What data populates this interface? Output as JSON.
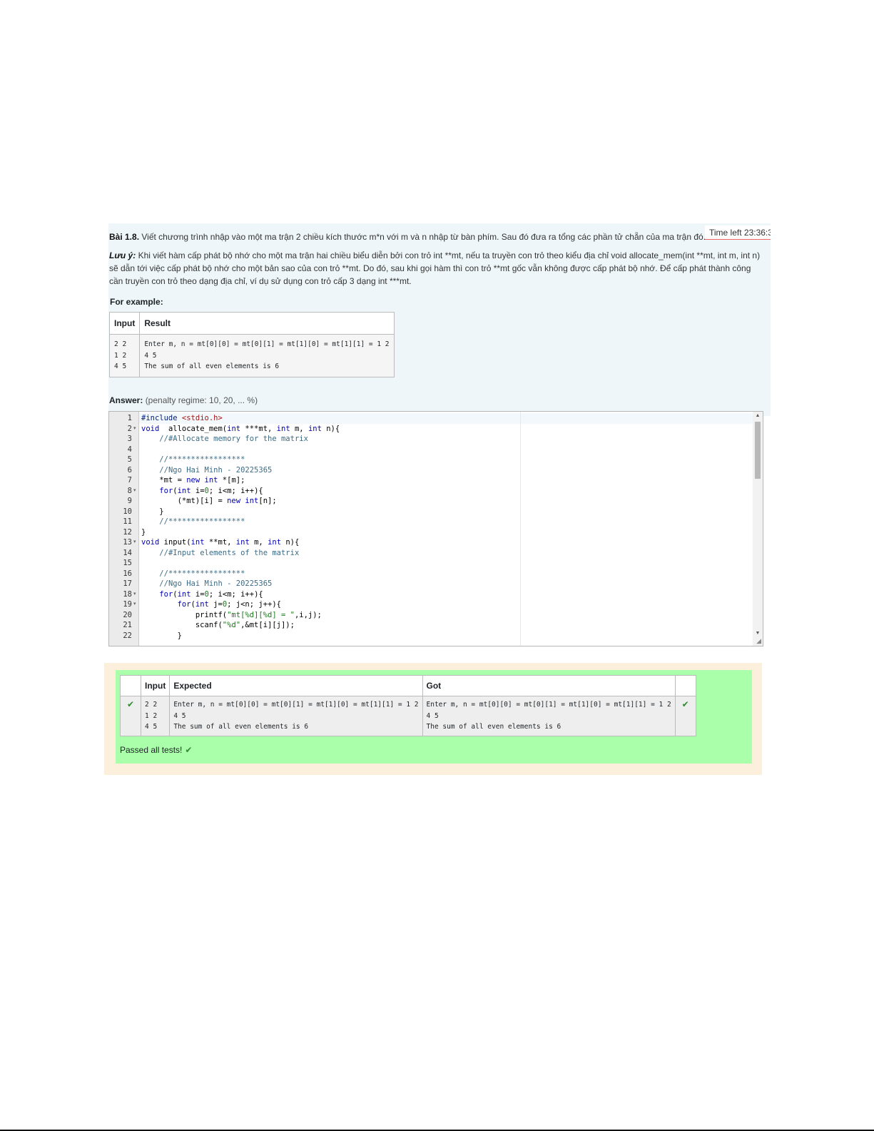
{
  "question": {
    "number_label": "Bài 1.8.",
    "text": "Viết chương trình nhập vào một ma trận 2 chiều kích thước m*n với m và n nhập từ bàn phím. Sau đó đưa ra tổng các phần tử chẵn của ma trận đó.",
    "note_label": "Lưu ý:",
    "note_text": "Khi viết hàm cấp phát bộ nhớ cho một ma trận hai chiều biểu diễn bởi con trỏ int **mt, nếu ta truyền con trỏ theo kiểu địa chỉ void allocate_mem(int **mt, int m, int n) sẽ dẫn tới việc cấp phát bộ nhớ cho một bản sao của con trỏ **mt. Do đó, sau khi gọi hàm thì con trỏ **mt gốc vẫn không được cấp phát bộ nhớ. Để cấp phát thành công cần truyền con trỏ theo dạng địa chỉ, ví dụ sử dụng con trỏ cấp 3 dạng int ***mt.",
    "example_label": "For example:"
  },
  "timer": {
    "label": "Time left 23:36:3"
  },
  "example_table": {
    "headers": [
      "Input",
      "Result"
    ],
    "input": "2 2\n1 2\n4 5",
    "result": "Enter m, n = mt[0][0] = mt[0][1] = mt[1][0] = mt[1][1] = 1 2\n4 5\nThe sum of all even elements is 6"
  },
  "answer": {
    "label": "Answer:",
    "penalty": "(penalty regime: 10, 20, ... %)"
  },
  "editor": {
    "line_numbers": [
      "1",
      "2",
      "3",
      "4",
      "5",
      "6",
      "7",
      "8",
      "9",
      "10",
      "11",
      "12",
      "13",
      "14",
      "15",
      "16",
      "17",
      "18",
      "19",
      "20",
      "21",
      "22"
    ],
    "fold_lines": [
      2,
      8,
      13,
      18,
      19
    ],
    "lines": [
      [
        [
          "pre",
          "#include "
        ],
        [
          "inc",
          "<stdio.h>"
        ]
      ],
      [
        [
          "kw",
          "void"
        ],
        [
          "",
          "  allocate_mem("
        ],
        [
          "kw",
          "int"
        ],
        [
          "",
          " ***mt, "
        ],
        [
          "kw",
          "int"
        ],
        [
          "",
          " m, "
        ],
        [
          "kw",
          "int"
        ],
        [
          "",
          " n){"
        ]
      ],
      [
        [
          "",
          "    "
        ],
        [
          "cm",
          "//#Allocate memory for the matrix"
        ]
      ],
      [
        [
          "",
          ""
        ]
      ],
      [
        [
          "",
          "    "
        ],
        [
          "cm",
          "//*****************"
        ]
      ],
      [
        [
          "",
          "    "
        ],
        [
          "cm",
          "//Ngo Hai Minh - 20225365"
        ]
      ],
      [
        [
          "",
          "    *mt = "
        ],
        [
          "kw",
          "new"
        ],
        [
          "",
          " "
        ],
        [
          "kw",
          "int"
        ],
        [
          "",
          " *[m];"
        ]
      ],
      [
        [
          "",
          "    "
        ],
        [
          "kw",
          "for"
        ],
        [
          "",
          "("
        ],
        [
          "kw",
          "int"
        ],
        [
          "",
          " i="
        ],
        [
          "str",
          "0"
        ],
        [
          "",
          "; i<m; i++){"
        ]
      ],
      [
        [
          "",
          "        (*mt)[i] = "
        ],
        [
          "kw",
          "new"
        ],
        [
          "",
          " "
        ],
        [
          "kw",
          "int"
        ],
        [
          "",
          "[n];"
        ]
      ],
      [
        [
          "",
          "    }"
        ]
      ],
      [
        [
          "",
          "    "
        ],
        [
          "cm",
          "//*****************"
        ]
      ],
      [
        [
          "",
          "}"
        ]
      ],
      [
        [
          "kw",
          "void"
        ],
        [
          "",
          " input("
        ],
        [
          "kw",
          "int"
        ],
        [
          "",
          " **mt, "
        ],
        [
          "kw",
          "int"
        ],
        [
          "",
          " m, "
        ],
        [
          "kw",
          "int"
        ],
        [
          "",
          " n){"
        ]
      ],
      [
        [
          "",
          "    "
        ],
        [
          "cm",
          "//#Input elements of the matrix"
        ]
      ],
      [
        [
          "",
          ""
        ]
      ],
      [
        [
          "",
          "    "
        ],
        [
          "cm",
          "//*****************"
        ]
      ],
      [
        [
          "",
          "    "
        ],
        [
          "cm",
          "//Ngo Hai Minh - 20225365"
        ]
      ],
      [
        [
          "",
          "    "
        ],
        [
          "kw",
          "for"
        ],
        [
          "",
          "("
        ],
        [
          "kw",
          "int"
        ],
        [
          "",
          " i="
        ],
        [
          "str",
          "0"
        ],
        [
          "",
          "; i<m; i++){"
        ]
      ],
      [
        [
          "",
          "        "
        ],
        [
          "kw",
          "for"
        ],
        [
          "",
          "("
        ],
        [
          "kw",
          "int"
        ],
        [
          "",
          " j="
        ],
        [
          "str",
          "0"
        ],
        [
          "",
          "; j<n; j++){"
        ]
      ],
      [
        [
          "",
          "            printf("
        ],
        [
          "str",
          "\"mt[%d][%d] = \""
        ],
        [
          "",
          ",i,j);"
        ]
      ],
      [
        [
          "",
          "            scanf("
        ],
        [
          "str",
          "\"%d\""
        ],
        [
          "",
          ",&mt[i][j]);"
        ]
      ],
      [
        [
          "",
          "        }"
        ]
      ]
    ]
  },
  "results_table": {
    "headers": [
      "",
      "Input",
      "Expected",
      "Got",
      ""
    ],
    "pass_mark": "✔",
    "input": "2 2\n1 2\n4 5",
    "expected": "Enter m, n = mt[0][0] = mt[0][1] = mt[1][0] = mt[1][1] = 1 2\n4 5\nThe sum of all even elements is 6",
    "got": "Enter m, n = mt[0][0] = mt[0][1] = mt[1][0] = mt[1][1] = 1 2\n4 5\nThe sum of all even elements is 6"
  },
  "summary": {
    "text": "Passed all tests!",
    "mark": "✔"
  }
}
